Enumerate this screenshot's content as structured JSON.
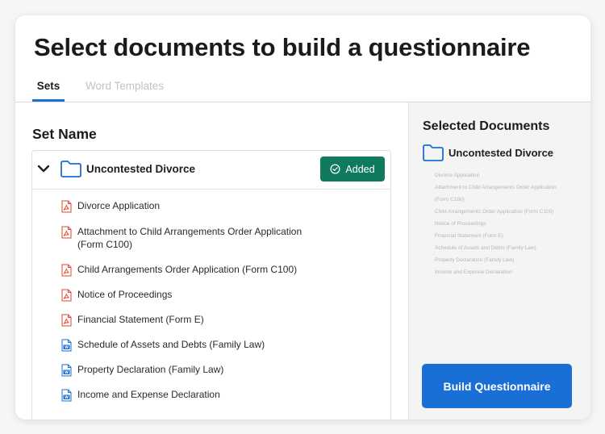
{
  "page": {
    "title": "Select documents to build a questionnaire"
  },
  "tabs": [
    {
      "label": "Sets",
      "active": true
    },
    {
      "label": "Word Templates",
      "active": false
    }
  ],
  "left": {
    "heading": "Set Name",
    "set": {
      "title": "Uncontested Divorce",
      "status_label": "Added",
      "documents": [
        {
          "label": "Divorce Application",
          "type": "pdf-icon"
        },
        {
          "label": "Attachment to Child Arrangements Order Application (Form C100)",
          "type": "pdf-icon"
        },
        {
          "label": "Child Arrangements Order Application (Form C100)",
          "type": "pdf-icon"
        },
        {
          "label": "Notice of Proceedings",
          "type": "pdf-icon"
        },
        {
          "label": "Financial Statement (Form E)",
          "type": "pdf-icon"
        },
        {
          "label": "Schedule of Assets and Debts (Family Law)",
          "type": "word-icon"
        },
        {
          "label": "Property Declaration (Family Law)",
          "type": "word-icon"
        },
        {
          "label": "Income and Expense Declaration",
          "type": "word-icon"
        }
      ]
    }
  },
  "right": {
    "heading": "Selected Documents",
    "set_title": "Uncontested Divorce",
    "documents": [
      "Divorce Application",
      "Attachment to Child Arrangements Order Application",
      "(Form C100)",
      "Child Arrangements Order Application (Form C100)",
      "Notice of Proceedings",
      "Financial Statement (Form E)",
      "Schedule of Assets and Debts (Family Law)",
      "Property Declaration (Family Law)",
      "Income and Expense Declaration"
    ],
    "build_button_label": "Build Questionnaire"
  },
  "colors": {
    "accent": "#1a6fd6",
    "added_green": "#0f7a5e",
    "pdf_red": "#e0452f",
    "word_blue": "#1a6fd6"
  }
}
